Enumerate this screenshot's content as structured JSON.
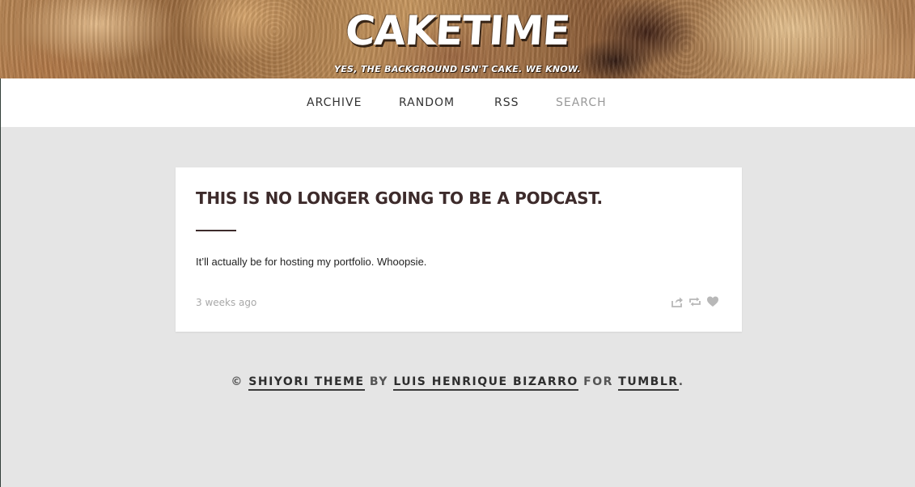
{
  "header": {
    "site_title": "CAKETIME",
    "tagline": "YES, THE BACKGROUND ISN'T CAKE. WE KNOW."
  },
  "nav": {
    "archive_label": "ARCHIVE",
    "random_label": "RANDOM",
    "rss_label": "RSS",
    "search_placeholder": "SEARCH"
  },
  "post": {
    "title": "THIS IS NO LONGER GOING TO BE A PODCAST.",
    "body": "It’ll actually be for hosting my portfolio.  Whoopsie.",
    "date": "3 weeks ago",
    "actions": {
      "share_icon": "share-icon",
      "reblog_icon": "reblog-icon",
      "like_icon": "heart-icon"
    }
  },
  "footer": {
    "copyright": "©",
    "theme_link": "SHIYORI THEME",
    "by": "BY",
    "author_link": "LUIS HENRIQUE BIZARRO",
    "for": "FOR",
    "platform_link": "TUMBLR",
    "end": "."
  },
  "colors": {
    "background": "#e5e5e5",
    "card": "#ffffff",
    "title": "#3d2b2b",
    "muted": "#a8a8a8",
    "nav_text": "#333333"
  }
}
